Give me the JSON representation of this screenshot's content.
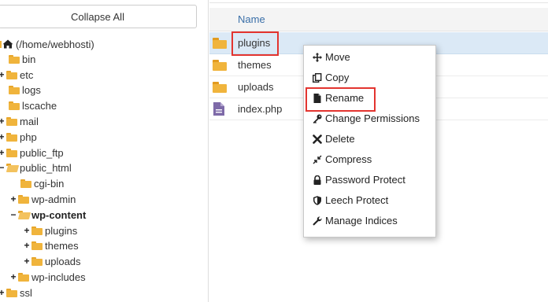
{
  "tree": {
    "collapse_label": "Collapse All",
    "root_label": "(/home/webhosti)",
    "items": [
      {
        "label": "bin"
      },
      {
        "label": "etc"
      },
      {
        "label": "logs"
      },
      {
        "label": "lscache"
      },
      {
        "label": "mail"
      },
      {
        "label": "php"
      },
      {
        "label": "public_ftp"
      },
      {
        "label": "public_html"
      },
      {
        "label": "cgi-bin"
      },
      {
        "label": "wp-admin"
      },
      {
        "label": "wp-content"
      },
      {
        "label": "plugins"
      },
      {
        "label": "themes"
      },
      {
        "label": "uploads"
      },
      {
        "label": "wp-includes"
      },
      {
        "label": "ssl"
      }
    ],
    "toggle_plus": "+",
    "toggle_minus": "−"
  },
  "files": {
    "name_header": "Name",
    "rows": [
      {
        "name": "plugins",
        "icon": "folder-icon"
      },
      {
        "name": "themes",
        "icon": "folder-icon"
      },
      {
        "name": "uploads",
        "icon": "folder-icon"
      },
      {
        "name": "index.php",
        "icon": "php-file-icon"
      }
    ]
  },
  "context_menu": {
    "items": [
      {
        "label": "Move",
        "icon": "move-icon"
      },
      {
        "label": "Copy",
        "icon": "copy-icon"
      },
      {
        "label": "Rename",
        "icon": "file-icon"
      },
      {
        "label": "Change Permissions",
        "icon": "key-icon"
      },
      {
        "label": "Delete",
        "icon": "x-icon"
      },
      {
        "label": "Compress",
        "icon": "compress-icon"
      },
      {
        "label": "Password Protect",
        "icon": "lock-icon"
      },
      {
        "label": "Leech Protect",
        "icon": "shield-icon"
      },
      {
        "label": "Manage Indices",
        "icon": "wrench-icon"
      }
    ]
  },
  "colors": {
    "folder": "#f0b43c",
    "highlight_red": "#e3342f",
    "selected_row": "#dbe9f6",
    "header_link": "#3a6fa8"
  }
}
